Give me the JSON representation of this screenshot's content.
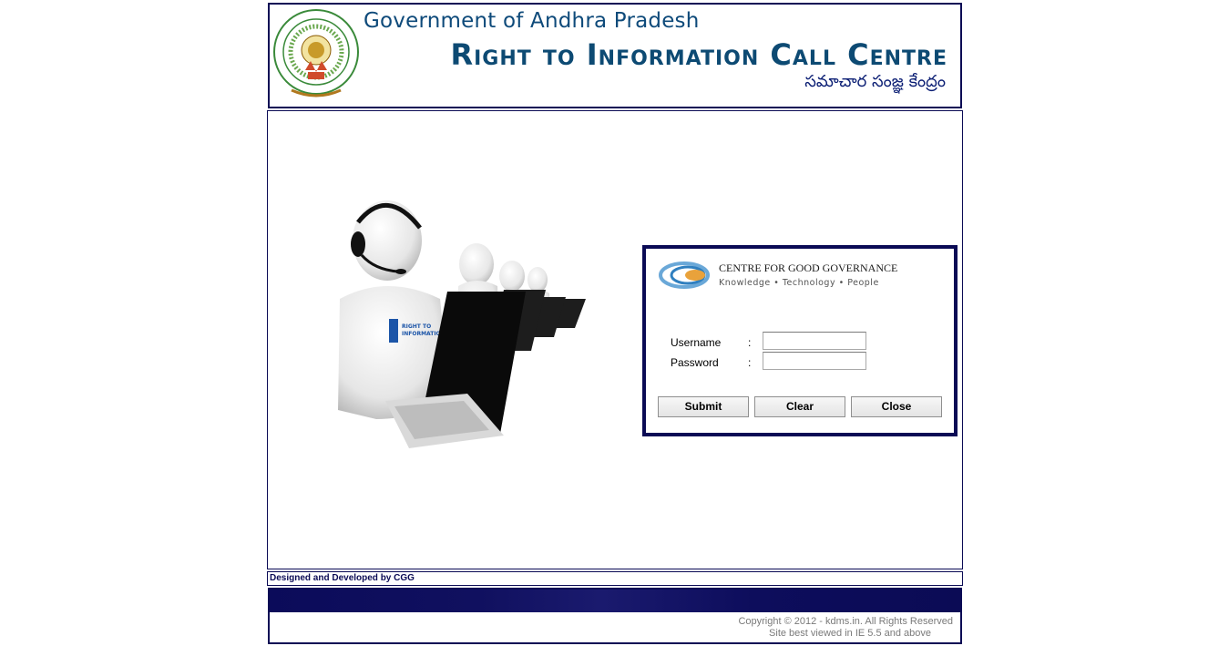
{
  "header": {
    "gov_title": "Government of Andhra Pradesh",
    "rti_title": "Right to Information Call Centre",
    "telugu_title": "సమాచార సంజ్ఞ కేంద్రం",
    "emblem_label": "GOVERNMENT OF ANDHRA PRADESH"
  },
  "login": {
    "org_name": "CENTRE FOR GOOD GOVERNANCE",
    "org_tagline": "Knowledge • Technology • People",
    "username_label": "Username",
    "password_label": "Password",
    "colon": ":",
    "username_value": "",
    "password_value": "",
    "submit_label": "Submit",
    "clear_label": "Clear",
    "close_label": "Close"
  },
  "illustration": {
    "badge_text": "RIGHT TO INFORMATION"
  },
  "credits": {
    "text": "Designed and Developed by CGG"
  },
  "footer": {
    "copyright": "Copyright © 2012 - kdms.in. All Rights Reserved",
    "browser_note": "Site best viewed in IE 5.5 and above"
  },
  "colors": {
    "border_navy": "#0b0b55",
    "title_blue": "#0d4a73",
    "footer_text": "#7a7a7a"
  }
}
